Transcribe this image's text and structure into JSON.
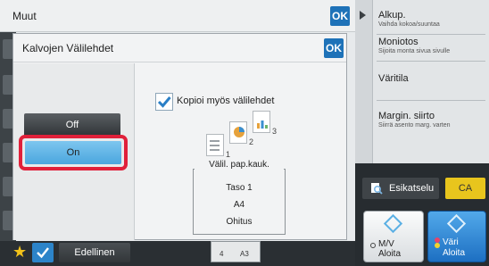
{
  "back_window": {
    "title": "Muut",
    "ok_label": "OK"
  },
  "dialog": {
    "title": "Kalvojen Välilehdet",
    "ok_label": "OK",
    "off_label": "Off",
    "on_label": "On",
    "on_selected": true,
    "copy_tabs_label": "Kopioi myös välilehdet",
    "copy_tabs_checked": true,
    "sheet_numbers": [
      "1",
      "2",
      "3"
    ],
    "paper_caption": "Välil. pap.kauk.",
    "paper_lines": [
      "Taso 1",
      "A4",
      "Ohitus"
    ]
  },
  "right_panel": {
    "items": [
      {
        "title": "Alkup.",
        "subtitle": "Vaihda kokoa/suuntaa"
      },
      {
        "title": "Moniotos",
        "subtitle": "Sijoita monta sivua sivulle"
      },
      {
        "title": "Väritila",
        "subtitle": ""
      },
      {
        "title": "Margin. siirto",
        "subtitle": "Siirrä asento marg. varten"
      }
    ],
    "preview_label": "Esikatselu",
    "ca_label": "CA",
    "start_mono": {
      "line1": "M/V",
      "line2": "Aloita"
    },
    "start_color": {
      "line1": "Väri",
      "line2": "Aloita"
    }
  },
  "bottom_bar": {
    "previous_label": "Edellinen",
    "tray_labels": [
      "4",
      "A3"
    ]
  },
  "colors": {
    "accent_blue": "#1e72b8",
    "selected_button": "#4aa6de",
    "highlight_red": "#e0203a",
    "ca_yellow": "#e8c51d"
  },
  "icons": [
    "play-icon",
    "check-icon",
    "document-stack-icon",
    "preview-icon",
    "star-icon",
    "mono-start-icon",
    "color-start-icon"
  ]
}
